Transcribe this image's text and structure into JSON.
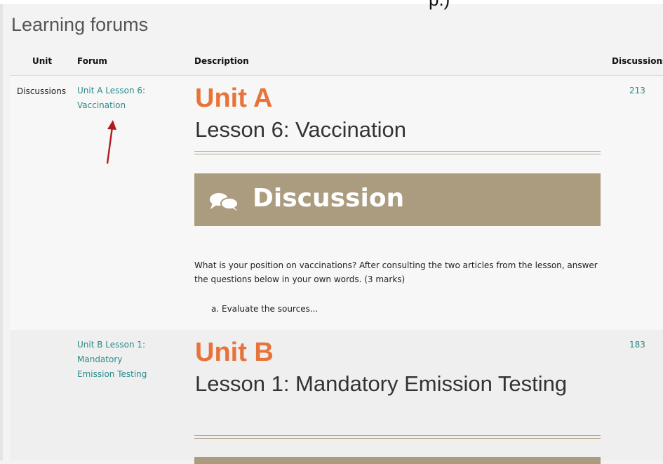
{
  "top_clip_glyph": "p.)",
  "page": {
    "title": "Learning forums"
  },
  "table": {
    "headers": {
      "unit": "Unit",
      "forum": "Forum",
      "description": "Description",
      "discussions": "Discussions"
    },
    "rows": [
      {
        "unit": "Discussions",
        "forum_link": "Unit A Lesson 6: Vaccination",
        "unit_heading": "Unit A",
        "lesson_title": "Lesson 6: Vaccination",
        "banner_label": "Discussion",
        "description": "What is your position on vaccinations? After consulting the two articles from the lesson, answer the questions below in your own words. (3 marks)",
        "sub_item": "a. Evaluate the sources...",
        "discussions": "213"
      },
      {
        "unit": "",
        "forum_link": "Unit B Lesson 1: Mandatory Emission Testing",
        "unit_heading": "Unit B",
        "lesson_title": "Lesson 1: Mandatory Emission Testing",
        "discussions": "183"
      }
    ]
  },
  "colors": {
    "accent_orange": "#e8733a",
    "link_teal": "#2a8a8a",
    "banner_tan": "#ac9c7f",
    "annotation_arrow": "#b01c1c"
  },
  "icons": {
    "banner_icon": "chat-bubbles-icon",
    "annotation": "red-arrow-annotation"
  }
}
